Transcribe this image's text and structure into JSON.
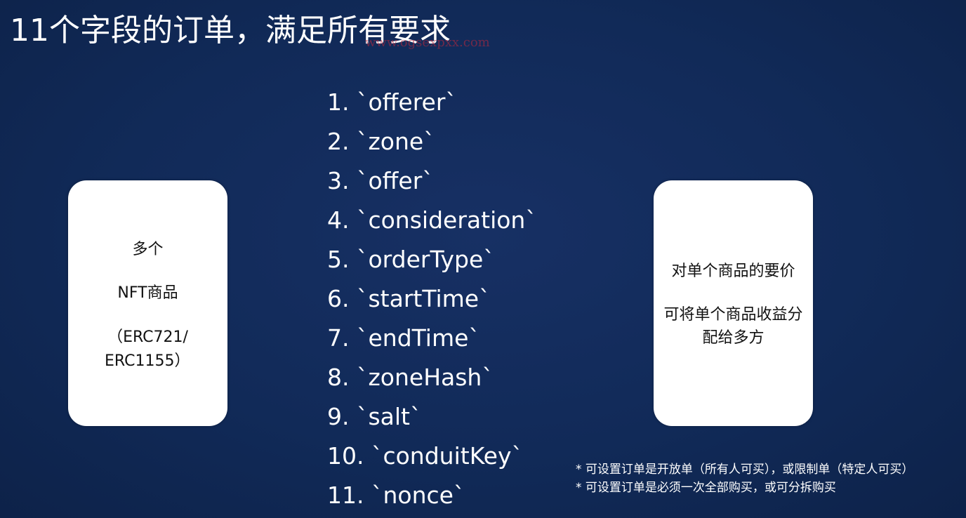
{
  "title": "11个字段的订单，满足所有要求",
  "watermark": "www.ogsexpxx.com",
  "left_card": {
    "line1": "多个",
    "line2": "NFT商品",
    "line3": "（ERC721/",
    "line4": "ERC1155）"
  },
  "fields": [
    "1. `offerer`",
    "2. `zone`",
    "3. `offer`",
    "4. `consideration`",
    "5. `orderType`",
    "6. `startTime`",
    "7. `endTime`",
    "8. `zoneHash`",
    "9. `salt`",
    "10. `conduitKey`",
    "11. `nonce`"
  ],
  "right_card": {
    "line1": "对单个商品的要价",
    "line2": "可将单个商品收益分",
    "line3": "配给多方"
  },
  "notes": [
    "* 可设置订单是开放单（所有人可买），或限制单（特定人可买）",
    "* 可设置订单是必须一次全部购买，或可分拆购买"
  ]
}
